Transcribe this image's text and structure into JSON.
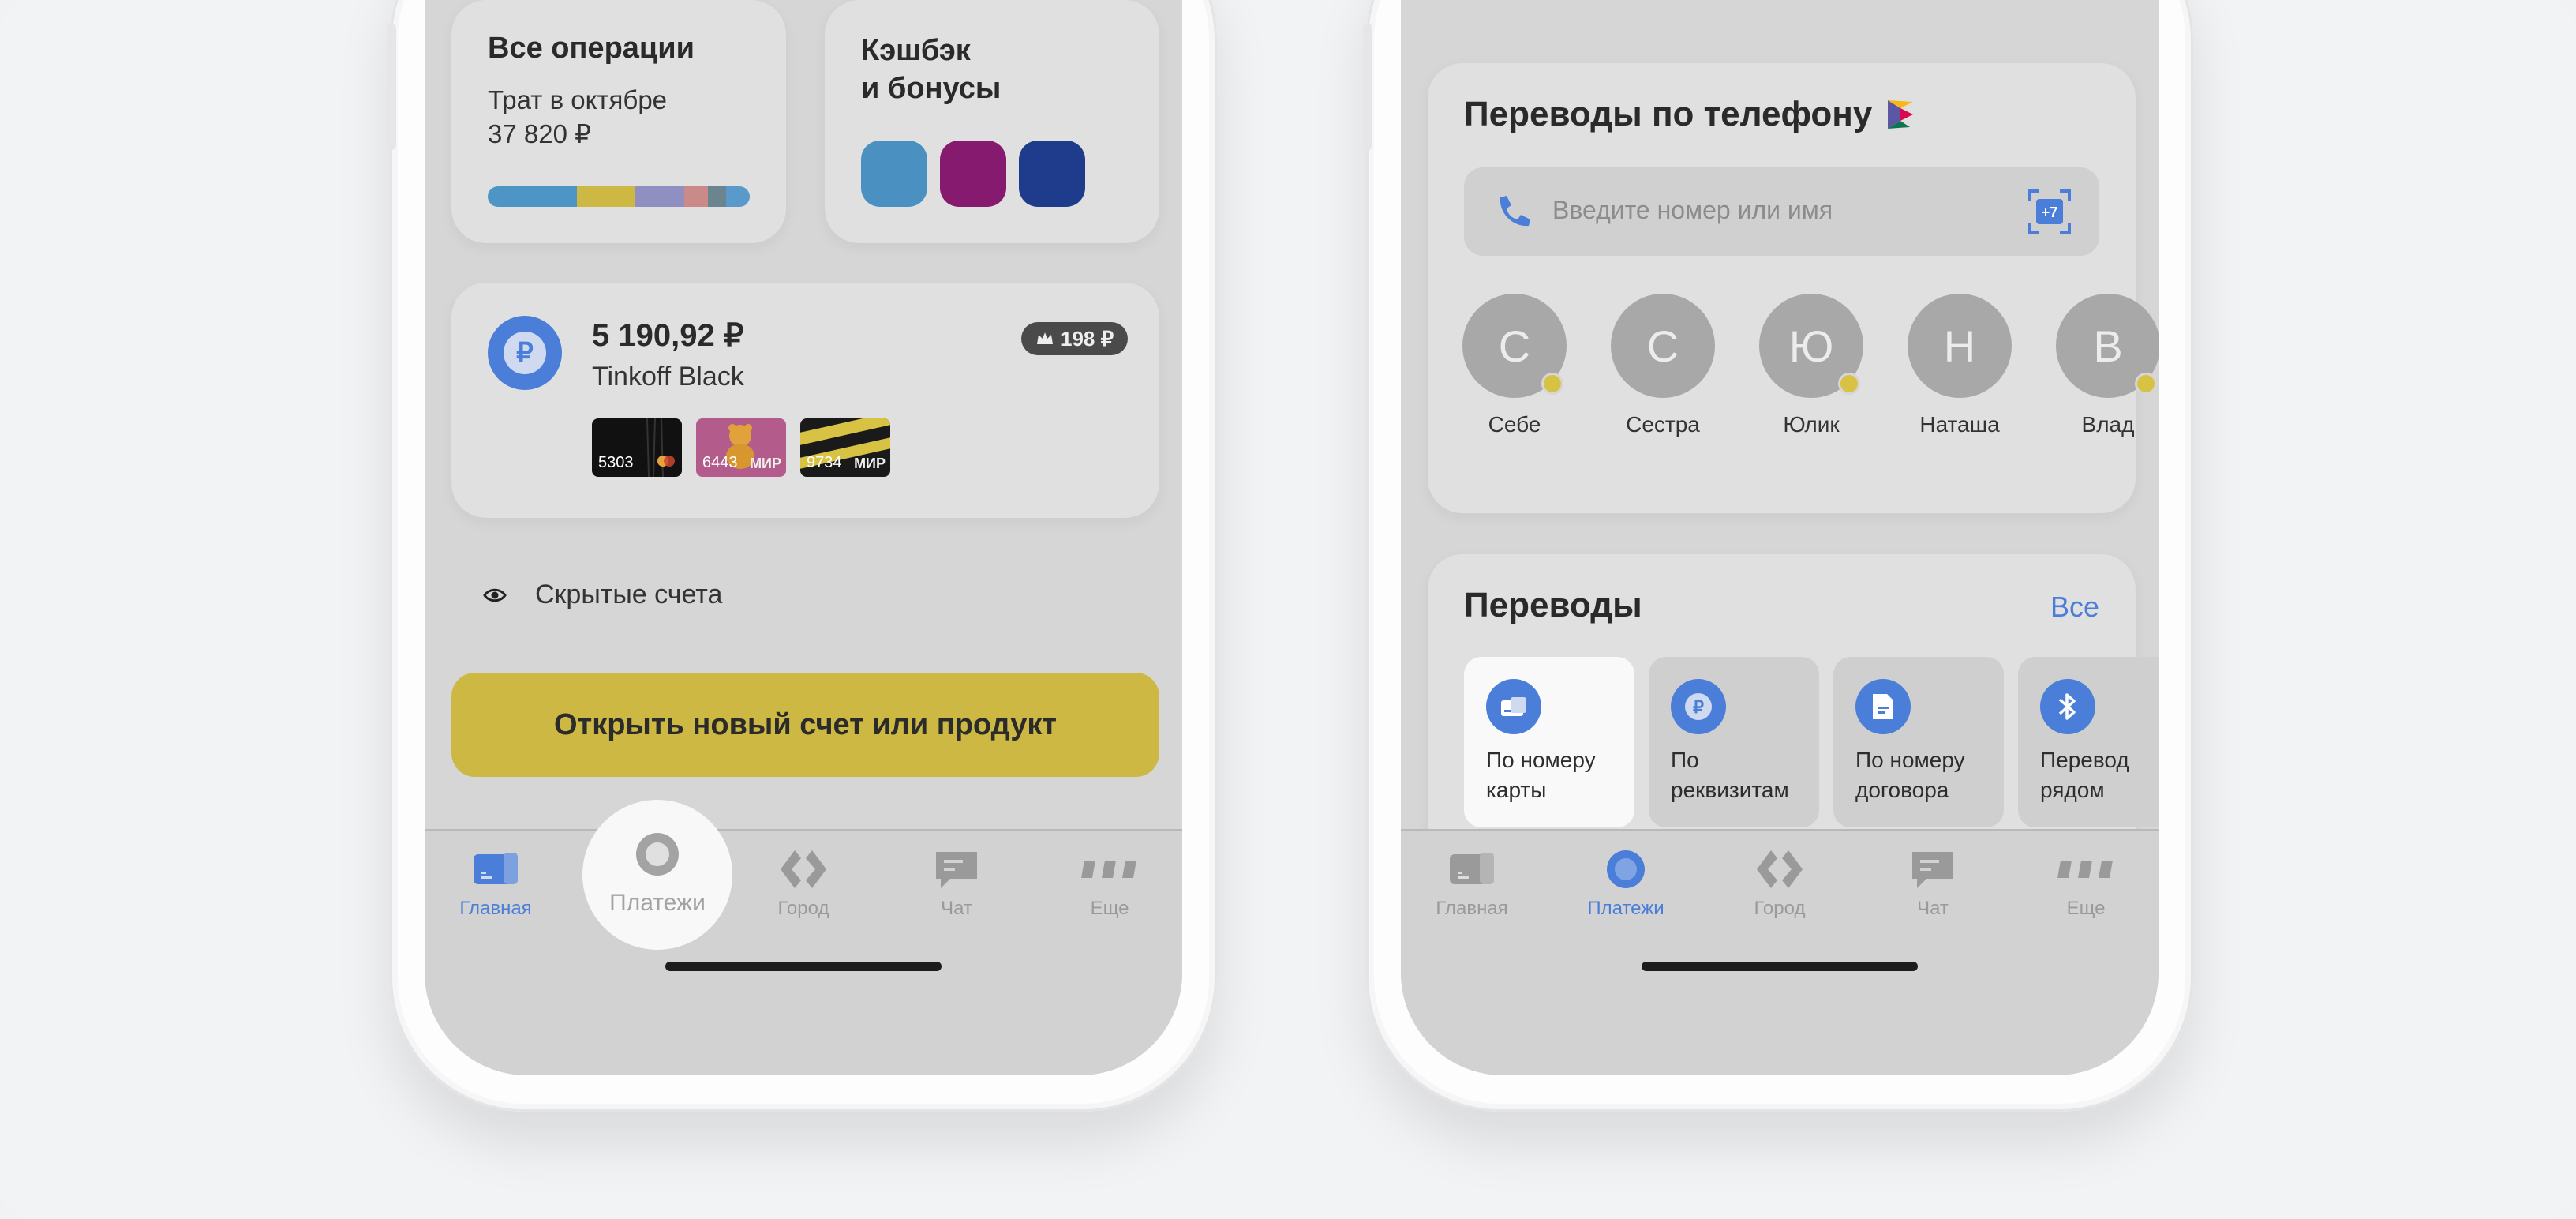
{
  "left_screen": {
    "all_operations": {
      "title": "Все операции",
      "subtitle": "Трат в октябре",
      "amount": "37 820 ₽",
      "segments": [
        {
          "color": "#4d95c4",
          "share": 0.34
        },
        {
          "color": "#cdb844",
          "share": 0.22
        },
        {
          "color": "#8f8fc2",
          "share": 0.19
        },
        {
          "color": "#c98a88",
          "share": 0.09
        },
        {
          "color": "#6b8590",
          "share": 0.07
        },
        {
          "color": "#5a9acb",
          "share": 0.09
        }
      ]
    },
    "cashback": {
      "title_line1": "Кэшбэк",
      "title_line2": "и бонусы",
      "squares": [
        "#4a90c0",
        "#861a6e",
        "#1f3c8c"
      ]
    },
    "account": {
      "amount": "5 190,92 ₽",
      "name": "Tinkoff Black",
      "badge": "198 ₽",
      "currency_symbol": "₽",
      "cards": [
        {
          "number": "5303",
          "payment": "",
          "style": "black"
        },
        {
          "number": "6443",
          "payment": "МИР",
          "style": "pink"
        },
        {
          "number": "9734",
          "payment": "МИР",
          "style": "tape"
        }
      ]
    },
    "hidden_accounts": "Скрытые счета",
    "new_product_button": "Открыть новый счет или продукт",
    "tabbar": {
      "items": [
        {
          "label": "Главная",
          "icon": "home-card-icon",
          "active": true
        },
        {
          "label": "Платежи",
          "icon": "payments-circle-icon",
          "highlighted": true
        },
        {
          "label": "Город",
          "icon": "city-diamond-icon"
        },
        {
          "label": "Чат",
          "icon": "chat-bubble-icon"
        },
        {
          "label": "Еще",
          "icon": "more-dots-icon"
        }
      ]
    }
  },
  "right_screen": {
    "phone_transfers": {
      "title": "Переводы по телефону",
      "search_placeholder": "Введите номер или имя",
      "search_right_icon_text": "+7",
      "contacts": [
        {
          "initial": "С",
          "name": "Себе",
          "dot": true
        },
        {
          "initial": "С",
          "name": "Сестра",
          "dot": false
        },
        {
          "initial": "Ю",
          "name": "Юлик",
          "dot": true
        },
        {
          "initial": "Н",
          "name": "Наташа",
          "dot": false
        },
        {
          "initial": "В",
          "name": "Влад",
          "dot": true
        }
      ]
    },
    "transfers": {
      "title": "Переводы",
      "all_link": "Все",
      "tiles": [
        {
          "label": "По номеру\nкарты",
          "icon": "card-icon",
          "selected": true
        },
        {
          "label": "По\nреквизитам",
          "icon": "ruble-icon",
          "selected": false
        },
        {
          "label": "По номеру\nдоговора",
          "icon": "document-icon",
          "selected": false
        },
        {
          "label": "Перевод\nрядом",
          "icon": "bluetooth-icon",
          "selected": false
        }
      ]
    },
    "tabbar": {
      "items": [
        {
          "label": "Главная",
          "icon": "home-card-icon"
        },
        {
          "label": "Платежи",
          "icon": "payments-circle-icon",
          "active": true
        },
        {
          "label": "Город",
          "icon": "city-diamond-icon"
        },
        {
          "label": "Чат",
          "icon": "chat-bubble-icon"
        },
        {
          "label": "Еще",
          "icon": "more-dots-icon"
        }
      ]
    }
  },
  "colors": {
    "accent_blue": "#4a7ed9",
    "yellow": "#cdb844",
    "screen_dim": "#d6d6d6"
  }
}
